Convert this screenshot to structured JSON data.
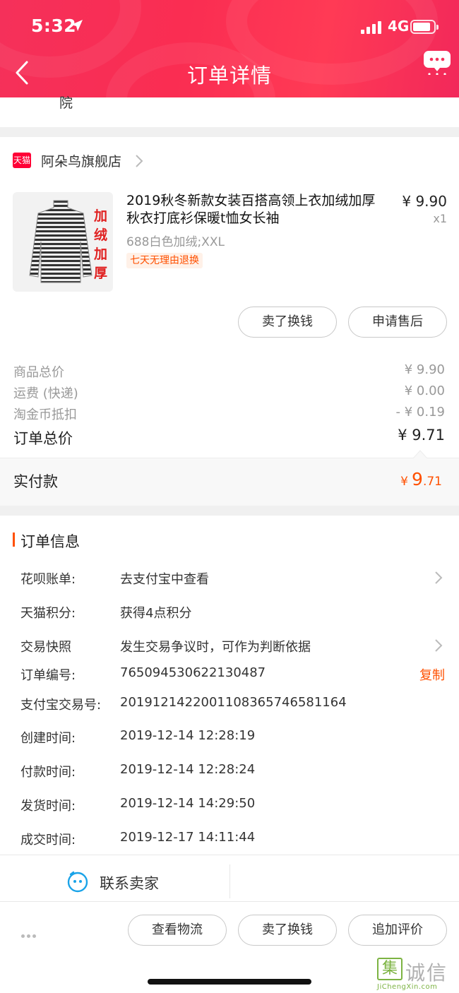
{
  "status_bar": {
    "time": "5:32",
    "network": "4G"
  },
  "header": {
    "title": "订单详情"
  },
  "prev_section_text": "院",
  "store": {
    "tag": "天猫",
    "name": "阿朵鸟旗舰店"
  },
  "product": {
    "title": "2019秋冬新款女装百搭高领上衣加绒加厚秋衣打底衫保暖t恤女长袖",
    "price": "¥ 9.90",
    "qty": "x1",
    "sku": "688白色加绒;XXL",
    "badge": "七天无理由退换",
    "image_text": [
      "加",
      "绒",
      "加",
      "厚"
    ]
  },
  "product_actions": {
    "sell": "卖了换钱",
    "after_sale": "申请售后"
  },
  "price_summary": {
    "rows": [
      {
        "label": "商品总价",
        "value": "¥ 9.90"
      },
      {
        "label": "运费 (快递)",
        "value": "¥ 0.00"
      },
      {
        "label": "淘金币抵扣",
        "value": "- ¥ 0.19"
      }
    ],
    "total_label": "订单总价",
    "total_value": "¥ 9.71"
  },
  "paid": {
    "label": "实付款",
    "currency": "¥",
    "integer": "9",
    "decimal": ".71"
  },
  "order_info": {
    "title": "订单信息",
    "copy_label": "复制",
    "rows": [
      {
        "label": "花呗账单:",
        "value": "去支付宝中查看"
      },
      {
        "label": "天猫积分:",
        "value": "获得4点积分"
      },
      {
        "label": "交易快照",
        "value": "发生交易争议时，可作为判断依据"
      },
      {
        "label": "订单编号:",
        "value": "765094530622130487"
      },
      {
        "label": "支付宝交易号:",
        "value": "2019121422001108365746581164"
      },
      {
        "label": "创建时间:",
        "value": "2019-12-14 12:28:19"
      },
      {
        "label": "付款时间:",
        "value": "2019-12-14 12:28:24"
      },
      {
        "label": "发货时间:",
        "value": "2019-12-14 14:29:50"
      },
      {
        "label": "成交时间:",
        "value": "2019-12-17 14:11:44"
      }
    ]
  },
  "contact": {
    "label": "联系卖家"
  },
  "bottom_actions": {
    "logistics": "查看物流",
    "sell": "卖了换钱",
    "review": "追加评价"
  },
  "watermark": {
    "logo": "集",
    "text": "诚信",
    "url": "JiChengXin.com"
  },
  "colors": {
    "brand": "#fa2d52",
    "accent": "#ff5000",
    "tmall": "#ff0036"
  }
}
